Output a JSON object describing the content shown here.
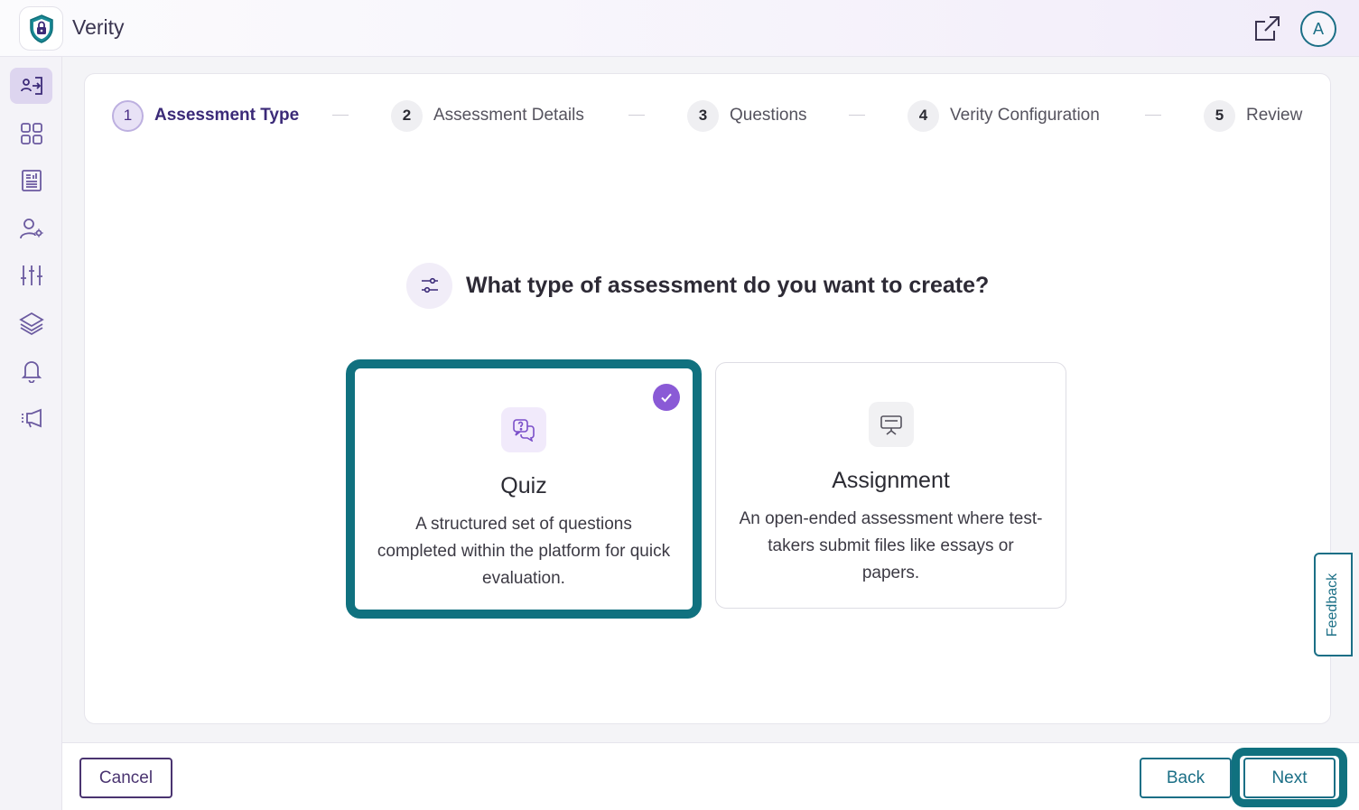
{
  "header": {
    "app_title": "Verity",
    "avatar_initial": "A"
  },
  "sidebar": {
    "items": [
      {
        "name": "user-switch-icon",
        "active": true
      },
      {
        "name": "grid-icon",
        "active": false
      },
      {
        "name": "report-icon",
        "active": false
      },
      {
        "name": "user-settings-icon",
        "active": false
      },
      {
        "name": "sliders-icon",
        "active": false
      },
      {
        "name": "layers-icon",
        "active": false
      },
      {
        "name": "bell-icon",
        "active": false
      },
      {
        "name": "megaphone-icon",
        "active": false
      }
    ]
  },
  "stepper": {
    "steps": [
      {
        "num": "1",
        "label": "Assessment Type",
        "active": true
      },
      {
        "num": "2",
        "label": "Assessment Details",
        "active": false
      },
      {
        "num": "3",
        "label": "Questions",
        "active": false
      },
      {
        "num": "4",
        "label": "Verity Configuration",
        "active": false
      },
      {
        "num": "5",
        "label": "Review",
        "active": false
      }
    ]
  },
  "main": {
    "question": "What type of assessment do you want to create?",
    "options": [
      {
        "title": "Quiz",
        "description": "A structured set of questions completed within the platform for quick evaluation.",
        "selected": true,
        "icon": "quiz-chat-icon"
      },
      {
        "title": "Assignment",
        "description": "An open-ended assessment where test-takers submit files like essays or papers.",
        "selected": false,
        "icon": "presentation-board-icon"
      }
    ]
  },
  "feedback_label": "Feedback",
  "footer": {
    "cancel_label": "Cancel",
    "back_label": "Back",
    "next_label": "Next"
  },
  "colors": {
    "accent_teal": "#10717f",
    "accent_purple": "#8a5ad6",
    "brand_dark": "#4a3470"
  }
}
